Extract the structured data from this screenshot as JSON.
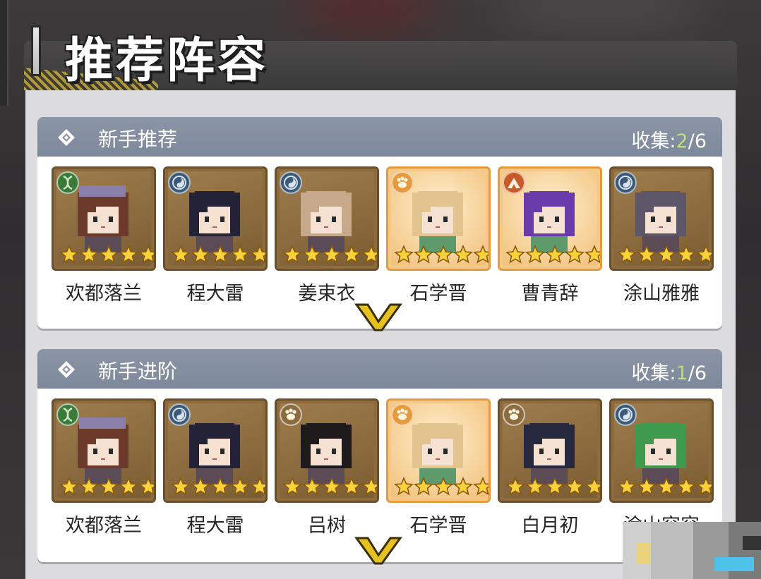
{
  "page_title": "推荐阵容",
  "sections": [
    {
      "title": "新手推荐",
      "collect_label": "收集:",
      "collect_current": "2",
      "collect_total": "/6",
      "heroes": [
        {
          "name": "欢都落兰",
          "frame": "bronze",
          "badge": "dna-icon",
          "badge_color": "#3c7a3a",
          "hair": "#6b3a2a",
          "hat": "#8a7fa8",
          "stars": 5
        },
        {
          "name": "程大雷",
          "frame": "bronze",
          "badge": "swirl-icon",
          "badge_color": "#3c5a78",
          "hair": "#242236",
          "hat": "",
          "stars": 5
        },
        {
          "name": "姜束衣",
          "frame": "bronze",
          "badge": "swirl-icon",
          "badge_color": "#3c5a78",
          "hair": "#c6a98a",
          "hat": "",
          "stars": 5
        },
        {
          "name": "石学晋",
          "frame": "gold",
          "badge": "paw-icon",
          "badge_color": "#e49a3d",
          "hair": "#e2c48e",
          "hat": "",
          "stars": 5
        },
        {
          "name": "曹青辞",
          "frame": "gold",
          "badge": "mountain-icon",
          "badge_color": "#c85a2a",
          "hair": "#6a3cab",
          "hat": "",
          "stars": 5
        },
        {
          "name": "涂山雅雅",
          "frame": "bronze",
          "badge": "swirl-icon",
          "badge_color": "#3c5a78",
          "hair": "#5c5668",
          "hat": "",
          "stars": 5
        }
      ]
    },
    {
      "title": "新手进阶",
      "collect_label": "收集:",
      "collect_current": "1",
      "collect_total": "/6",
      "heroes": [
        {
          "name": "欢都落兰",
          "frame": "bronze",
          "badge": "dna-icon",
          "badge_color": "#3c7a3a",
          "hair": "#6b3a2a",
          "hat": "#8a7fa8",
          "stars": 5
        },
        {
          "name": "程大雷",
          "frame": "bronze",
          "badge": "swirl-icon",
          "badge_color": "#3c5a78",
          "hair": "#242236",
          "hat": "",
          "stars": 5
        },
        {
          "name": "吕树",
          "frame": "bronze",
          "badge": "paw-icon",
          "badge_color": "#8c6b3f",
          "hair": "#1e1a1c",
          "hat": "",
          "stars": 5
        },
        {
          "name": "石学晋",
          "frame": "gold",
          "badge": "paw-icon",
          "badge_color": "#e49a3d",
          "hair": "#e2c48e",
          "hat": "",
          "stars": 5
        },
        {
          "name": "白月初",
          "frame": "bronze",
          "badge": "paw-icon",
          "badge_color": "#8c6b3f",
          "hair": "#26283e",
          "hat": "",
          "stars": 5
        },
        {
          "name": "涂山容容",
          "frame": "bronze",
          "badge": "swirl-icon",
          "badge_color": "#3c5a78",
          "hair": "#3f9a4e",
          "hat": "",
          "stars": 5
        }
      ]
    }
  ],
  "colors": {
    "header_bg": "#8b95a6",
    "collect_highlight": "#b9e07a",
    "chevron": "#e6c21e"
  }
}
